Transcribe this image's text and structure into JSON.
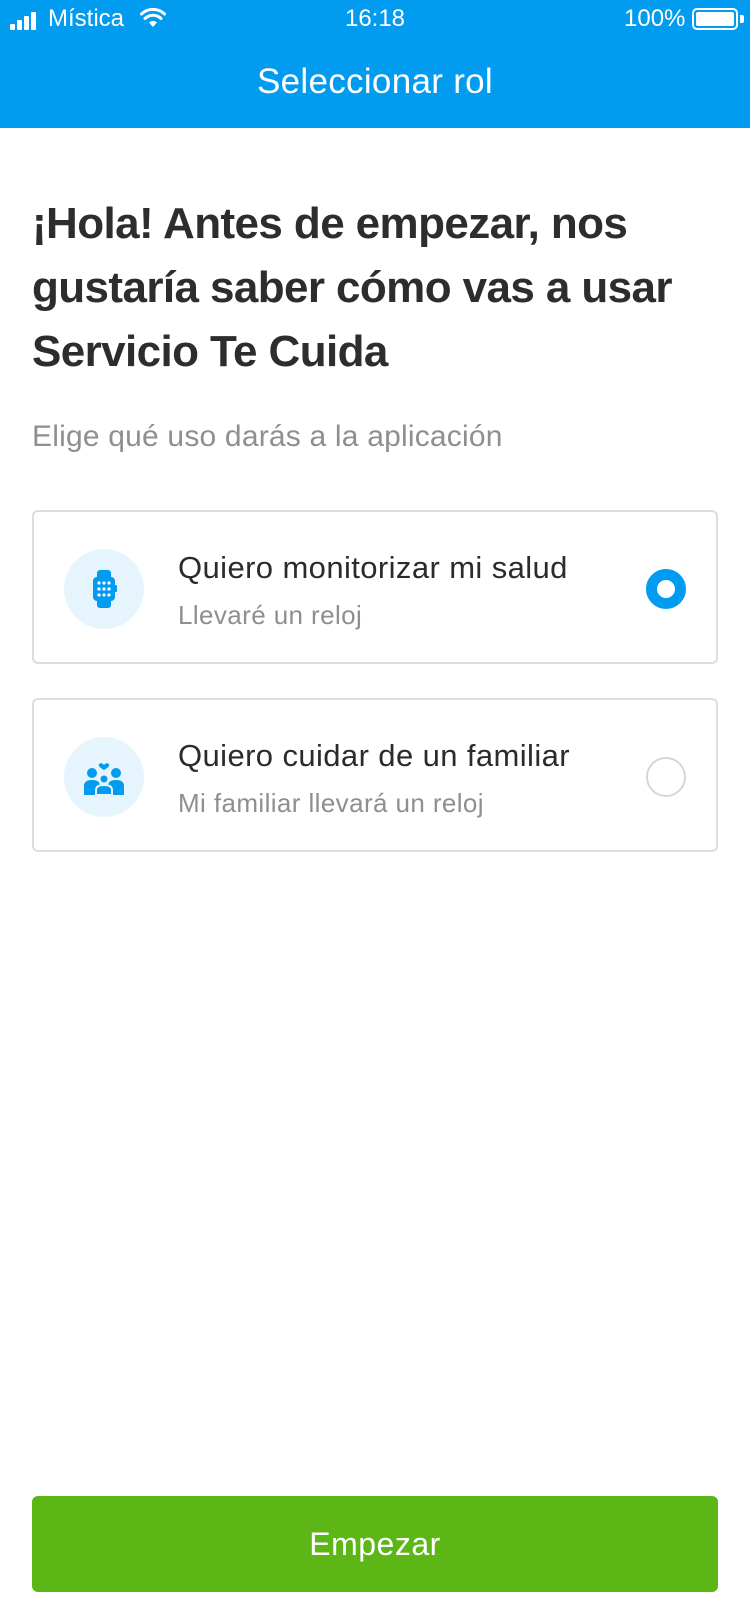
{
  "status_bar": {
    "carrier": "Mística",
    "time": "16:18",
    "battery_percent": "100%"
  },
  "nav": {
    "title": "Seleccionar rol"
  },
  "main": {
    "heading": "¡Hola! Antes de empezar, nos gustaría saber cómo vas a usar Servicio Te Cuida",
    "subheading": "Elige qué uso darás a la aplicación",
    "options": [
      {
        "title": "Quiero monitorizar mi salud",
        "subtitle": "Llevaré un reloj",
        "icon": "smartwatch-icon",
        "selected": true
      },
      {
        "title": "Quiero cuidar de un familiar",
        "subtitle": "Mi familiar llevará un reloj",
        "icon": "family-icon",
        "selected": false
      }
    ]
  },
  "footer": {
    "start_label": "Empezar"
  },
  "colors": {
    "primary": "#019cf0",
    "accent_green": "#5cb615",
    "icon_bg": "#e6f4fd"
  }
}
